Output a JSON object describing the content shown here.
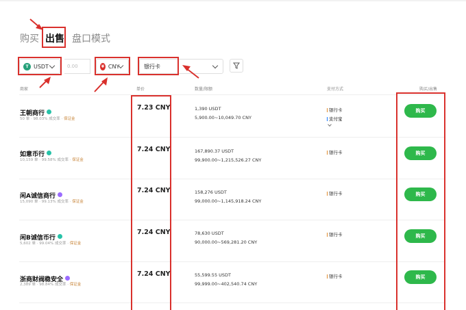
{
  "tabs": [
    {
      "label": "购买",
      "active": false
    },
    {
      "label": "出售",
      "active": true
    },
    {
      "label": "盘口模式",
      "active": false
    }
  ],
  "filters": {
    "crypto": {
      "value": "USDT",
      "icon": "usdt-coin-icon",
      "icon_letter": "T"
    },
    "amount": {
      "placeholder": "0.00"
    },
    "fiat": {
      "value": "CNY",
      "icon": "cny-coin-icon",
      "icon_letter": "¥"
    },
    "payment": {
      "value": "银行卡"
    }
  },
  "columns": [
    "商家",
    "单价",
    "数量/限额",
    "支付方式",
    "购买/出售"
  ],
  "rows": [
    {
      "merchant": "王朝商行",
      "badge_color": "#27c2a8",
      "orders": "50 单",
      "completion": "98.03% 成交率",
      "guarantee": "保证金",
      "price": "7.23 CNY",
      "quantity": "1,390 USDT",
      "limit": "5,900.00~10,049.70 CNY",
      "payments": [
        "银行卡",
        "支付宝"
      ],
      "has_more": true,
      "action": "购买"
    },
    {
      "merchant": "如意币行",
      "badge_color": "#27c2a8",
      "orders": "10,159 单",
      "completion": "99.58% 成交率",
      "guarantee": "保证金",
      "price": "7.24 CNY",
      "quantity": "167,890.37 USDT",
      "limit": "99,900.00~1,215,526.27 CNY",
      "payments": [
        "银行卡"
      ],
      "has_more": false,
      "action": "购买"
    },
    {
      "merchant": "闲A诚信商行",
      "badge_color": "#9b6cff",
      "orders": "15,090 单",
      "completion": "99.13% 成交率",
      "guarantee": "保证金",
      "price": "7.24 CNY",
      "quantity": "158,276 USDT",
      "limit": "99,000.00~1,145,918.24 CNY",
      "payments": [
        "银行卡"
      ],
      "has_more": false,
      "action": "购买"
    },
    {
      "merchant": "闲B诚信币行",
      "badge_color": "#27c2a8",
      "orders": "5,602 单",
      "completion": "99.04% 成交率",
      "guarantee": "保证金",
      "price": "7.24 CNY",
      "quantity": "78,630 USDT",
      "limit": "90,000.00~569,281.20 CNY",
      "payments": [
        "银行卡"
      ],
      "has_more": false,
      "action": "购买"
    },
    {
      "merchant": "浙商财阀稳安全",
      "badge_color": "#9b6cff",
      "orders": "2,389 单",
      "completion": "98.84% 成交率",
      "guarantee": "保证金",
      "price": "7.24 CNY",
      "quantity": "55,599.55 USDT",
      "limit": "99,999.00~402,540.74 CNY",
      "payments": [
        "银行卡"
      ],
      "has_more": false,
      "action": "购买"
    }
  ],
  "colors": {
    "highlight": "#d9302c",
    "buy_button": "#2eb84b",
    "badge_teal": "#27c2a8",
    "badge_purple": "#9b6cff",
    "guarantee": "#c8863b"
  }
}
